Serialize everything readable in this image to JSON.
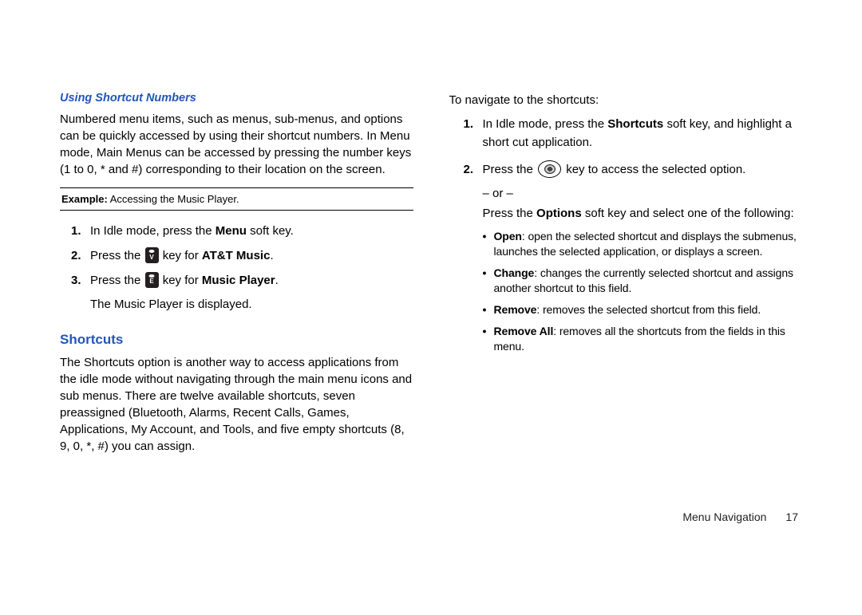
{
  "left": {
    "heading1": "Using Shortcut Numbers",
    "para1": "Numbered menu items, such as menus, sub-menus, and options can be quickly accessed by using their shortcut numbers. In Menu mode, Main Menus can be accessed by pressing the number keys (1 to 0, * and #) corresponding to their location on the screen.",
    "exampleLabel": "Example:",
    "exampleText": " Accessing the Music Player.",
    "step1_a": "In Idle mode, press the ",
    "step1_b": "Menu",
    "step1_c": " soft key.",
    "step2_a": "Press the ",
    "step2_b": " key for ",
    "step2_c": "AT&T Music",
    "step2_d": ".",
    "key2Label": "V",
    "step3_a": "Press the ",
    "step3_b": " key for ",
    "step3_c": "Music Player",
    "step3_d": ".",
    "key3Label": "E",
    "step3_sub": "The Music Player is displayed.",
    "heading2": "Shortcuts",
    "para2": "The Shortcuts option is another way to access applications from the idle mode without navigating through the main menu icons and sub menus. There are twelve available shortcuts, seven preassigned (Bluetooth, Alarms, Recent Calls, Games, Applications, My Account, and Tools, and five empty shortcuts (8, 9, 0, *, #) you can assign."
  },
  "right": {
    "intro": "To navigate to the shortcuts:",
    "step1_a": "In Idle mode, press the ",
    "step1_b": "Shortcuts",
    "step1_c": " soft key, and highlight a short cut application.",
    "step2_a": "Press the ",
    "step2_b": " key to access the selected option.",
    "or": "– or –",
    "orPara_a": "Press the ",
    "orPara_b": "Options",
    "orPara_c": " soft key and select one of the following:",
    "bullets": [
      {
        "b": "Open",
        "t": ": open the selected shortcut and displays the submenus, launches the selected application, or displays a screen."
      },
      {
        "b": "Change",
        "t": ": changes the currently selected shortcut and assigns another shortcut to this field."
      },
      {
        "b": "Remove",
        "t": ": removes the selected shortcut from this field."
      },
      {
        "b": "Remove All",
        "t": ": removes all the shortcuts from the fields in this menu."
      }
    ]
  },
  "footer": {
    "section": "Menu Navigation",
    "page": "17"
  }
}
